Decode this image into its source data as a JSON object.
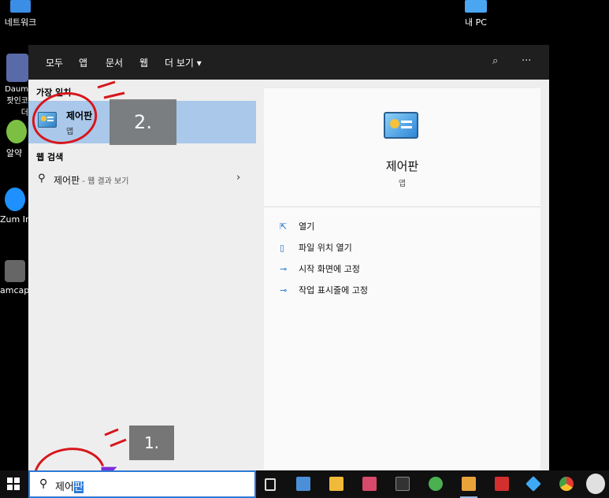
{
  "desktop": {
    "icons": [
      {
        "label": "네트워크"
      },
      {
        "label": "내 PC"
      },
      {
        "label": "Daum 팟인코더"
      },
      {
        "label": "알약"
      },
      {
        "label": "Zum Internet"
      },
      {
        "label": "amcap"
      }
    ]
  },
  "search_panel": {
    "tabs": [
      "모두",
      "앱",
      "문서",
      "웹",
      "더 보기 ▾"
    ],
    "topbar_icons": [
      "feedback-icon",
      "more-icon"
    ],
    "best_match_header": "가장 일치",
    "best_match": {
      "title": "제어판",
      "subtitle": "앱"
    },
    "web_search_header": "웹 검색",
    "web_result": {
      "query": "제어판",
      "suffix": " - 웹 결과 보기"
    },
    "preview": {
      "title": "제어판",
      "subtitle": "앱",
      "actions": [
        "열기",
        "파일 위치 열기",
        "시작 화면에 고정",
        "작업 표시줄에 고정"
      ]
    }
  },
  "annotations": {
    "step1": "1.",
    "step2": "2."
  },
  "taskbar": {
    "search_text": "제어",
    "search_selected": "판",
    "apps": [
      "task-view-icon",
      "calculator-icon",
      "file-explorer-icon",
      "app-icon",
      "terminal-icon",
      "utorrent-icon",
      "media-player-icon",
      "app-icon",
      "kodi-icon",
      "chrome-icon",
      "avatar-icon"
    ]
  }
}
